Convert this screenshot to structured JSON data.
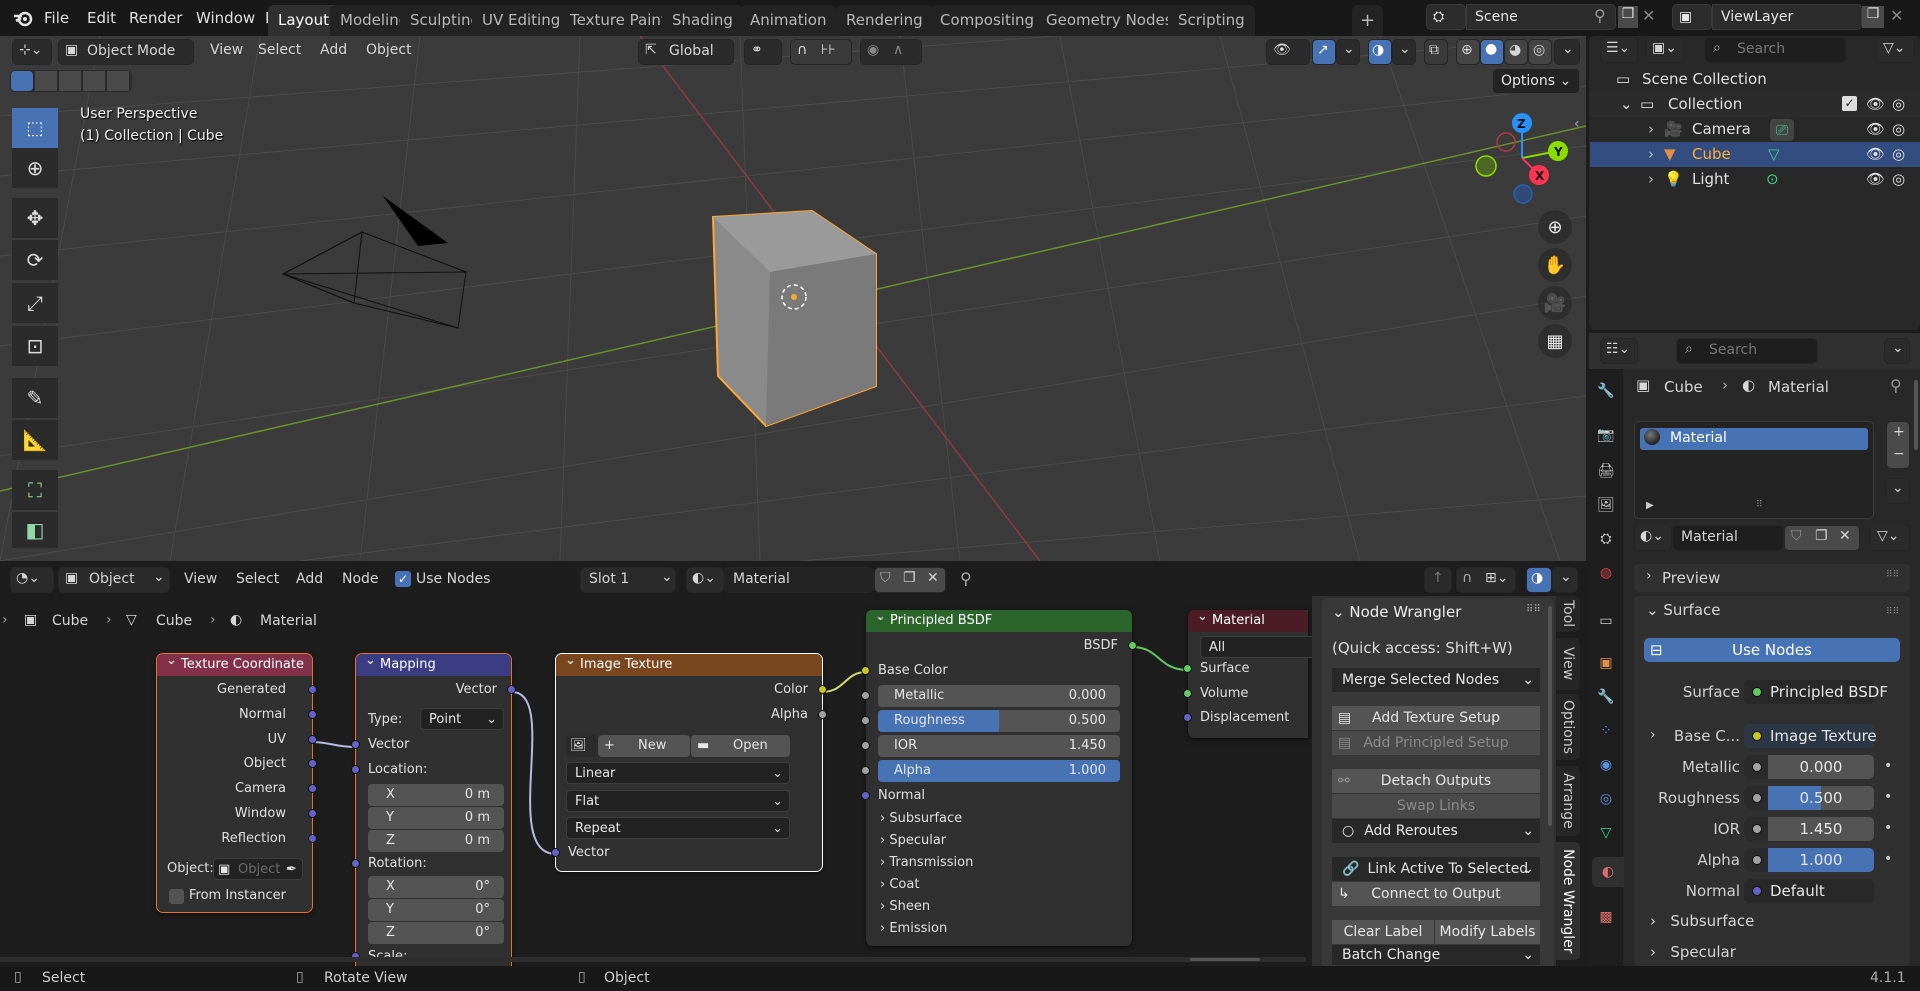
{
  "app": {
    "version": "4.1.1"
  },
  "menu": {
    "items": [
      "File",
      "Edit",
      "Render",
      "Window",
      "Help"
    ]
  },
  "workspaces": {
    "tabs": [
      "Layout",
      "Modeling",
      "Sculpting",
      "UV Editing",
      "Texture Paint",
      "Shading",
      "Animation",
      "Rendering",
      "Compositing",
      "Geometry Nodes",
      "Scripting"
    ],
    "active": "Layout",
    "add_label": "+"
  },
  "scene": {
    "name": "Scene",
    "view_layer": "ViewLayer"
  },
  "viewport": {
    "mode": "Object Mode",
    "menus": [
      "View",
      "Select",
      "Add",
      "Object"
    ],
    "transform_orientation": "Global",
    "options_label": "Options",
    "overlay_title": "User Perspective",
    "overlay_subtitle": "(1) Collection | Cube",
    "gizmo_axes": {
      "x": "X",
      "y": "Y",
      "z": "Z"
    },
    "colors": {
      "x_axis": "#ff3352",
      "y_axis": "#8bdc00",
      "z_axis": "#2890ff",
      "selection": "#ffa533",
      "active_button": "#4772b3"
    }
  },
  "outliner": {
    "search_placeholder": "Search",
    "root": "Scene Collection",
    "collection": "Collection",
    "items": [
      {
        "name": "Camera",
        "type": "camera",
        "selected": false
      },
      {
        "name": "Cube",
        "type": "mesh",
        "selected": true
      },
      {
        "name": "Light",
        "type": "light",
        "selected": false
      }
    ]
  },
  "properties": {
    "search_placeholder": "Search",
    "breadcrumb": [
      "Cube",
      "Material"
    ],
    "material_slots": [
      "Material"
    ],
    "material_name": "Material",
    "panels": {
      "preview": "Preview",
      "surface": "Surface"
    },
    "use_nodes_label": "Use Nodes",
    "fields": [
      {
        "label": "Surface",
        "value": "Principled BSDF",
        "socket": "green"
      },
      {
        "label": "Base C...",
        "value": "Image Texture",
        "socket": "yellow"
      },
      {
        "label": "Metallic",
        "value": "0.000",
        "fill": 0.0
      },
      {
        "label": "Roughness",
        "value": "0.500",
        "fill": 0.5
      },
      {
        "label": "IOR",
        "value": "1.450",
        "fill": 0.0
      },
      {
        "label": "Alpha",
        "value": "1.000",
        "fill": 1.0
      },
      {
        "label": "Normal",
        "value": "Default",
        "socket": "purple"
      }
    ],
    "subpanels": [
      "Subsurface",
      "Specular"
    ]
  },
  "node_editor": {
    "object_mode": "Object",
    "menus": [
      "View",
      "Select",
      "Add",
      "Node"
    ],
    "use_nodes_label": "Use Nodes",
    "use_nodes_checked": true,
    "slot": "Slot 1",
    "material": "Material",
    "breadcrumb": [
      "Cube",
      "Cube",
      "Material"
    ],
    "nodes": {
      "tex_coord": {
        "title": "Texture Coordinate",
        "outputs": [
          "Generated",
          "Normal",
          "UV",
          "Object",
          "Camera",
          "Window",
          "Reflection"
        ],
        "object_label": "Object:",
        "object_placeholder": "Object",
        "from_instancer": "From Instancer"
      },
      "mapping": {
        "title": "Mapping",
        "output": "Vector",
        "type_label": "Type:",
        "type_value": "Point",
        "input_vector": "Vector",
        "location_label": "Location:",
        "location": [
          {
            "axis": "X",
            "value": "0 m"
          },
          {
            "axis": "Y",
            "value": "0 m"
          },
          {
            "axis": "Z",
            "value": "0 m"
          }
        ],
        "rotation_label": "Rotation:",
        "rotation": [
          {
            "axis": "X",
            "value": "0°"
          },
          {
            "axis": "Y",
            "value": "0°"
          },
          {
            "axis": "Z",
            "value": "0°"
          }
        ],
        "scale_label": "Scale:"
      },
      "image_texture": {
        "title": "Image Texture",
        "outputs": [
          "Color",
          "Alpha"
        ],
        "new_label": "New",
        "open_label": "Open",
        "interpolation": "Linear",
        "projection": "Flat",
        "extension": "Repeat",
        "input": "Vector"
      },
      "principled": {
        "title": "Principled BSDF",
        "output": "BSDF",
        "base_color": "Base Color",
        "fields": [
          {
            "label": "Metallic",
            "value": "0.000",
            "fill": 0.0
          },
          {
            "label": "Roughness",
            "value": "0.500",
            "fill": 0.5
          },
          {
            "label": "IOR",
            "value": "1.450",
            "fill": 0.0
          },
          {
            "label": "Alpha",
            "value": "1.000",
            "fill": 1.0
          }
        ],
        "normal": "Normal",
        "panels": [
          "Subsurface",
          "Specular",
          "Transmission",
          "Coat",
          "Sheen",
          "Emission"
        ]
      },
      "output": {
        "title": "Material Output",
        "target": "All",
        "inputs": [
          "Surface",
          "Volume",
          "Displacement"
        ]
      }
    },
    "sidebar": {
      "panel_title": "Node Wrangler",
      "quick_access": "(Quick access: Shift+W)",
      "merge": "Merge Selected Nodes",
      "add_texture_setup": "Add Texture Setup",
      "add_principled_setup": "Add Principled Setup",
      "detach_outputs": "Detach Outputs",
      "swap_links": "Swap Links",
      "add_reroutes": "Add Reroutes",
      "link_active": "Link Active To Selected",
      "connect_output": "Connect to Output",
      "clear_label": "Clear Label",
      "modify_labels": "Modify Labels",
      "batch_change": "Batch Change",
      "tabs": [
        "Tool",
        "View",
        "Options",
        "Arrange",
        "Node Wrangler"
      ],
      "active_tab": "Node Wrangler"
    }
  },
  "statusbar": {
    "left_click": "Select",
    "middle_click": "Rotate View",
    "right_click": "Object",
    "version": "4.1.1"
  }
}
